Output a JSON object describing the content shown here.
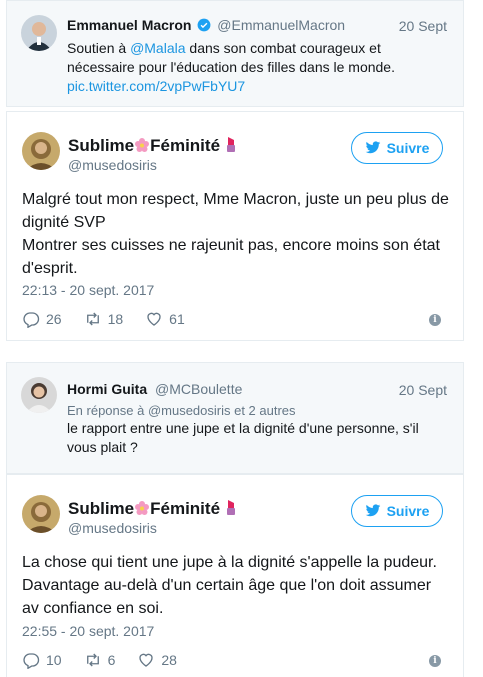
{
  "tweet1": {
    "name": "Emmanuel Macron",
    "handle": "@EmmanuelMacron",
    "date": "20 Sept",
    "text_line1_pre": "Soutien à ",
    "mention": "@Malala",
    "text_line1_post": " dans son combat courageux et",
    "text_line2": "nécessaire pour l'éducation des filles dans le monde.",
    "link": "pic.twitter.com/2vpPwFbYU7"
  },
  "tweet2": {
    "name_part1": "Sublime",
    "name_part2": "Féminité",
    "handle": "@musedosiris",
    "follow_label": "Suivre",
    "text_line1": "Malgré tout mon respect, Mme Macron, juste un peu plus de",
    "text_line2": "dignité SVP",
    "text_line3": "Montrer ses cuisses ne rajeunit pas, encore moins son état",
    "text_line4": "d'esprit.",
    "timestamp": "22:13 - 20 sept. 2017",
    "replies": "26",
    "retweets": "18",
    "likes": "61"
  },
  "tweet3": {
    "name": "Hormi Guita",
    "handle": "@MCBoulette",
    "date": "20 Sept",
    "reply_to": "En réponse à @musedosiris et 2 autres",
    "text_line1": "le rapport entre une jupe et la dignité d'une personne, s'il",
    "text_line2": "vous plait ?"
  },
  "tweet4": {
    "name_part1": "Sublime",
    "name_part2": "Féminité",
    "handle": "@musedosiris",
    "follow_label": "Suivre",
    "text_line1": "La chose qui tient une jupe à la dignité s'appelle la pudeur.",
    "text_line2": "Davantage au-delà d'un certain âge que l'on doit assumer",
    "text_line3": "av confiance en soi.",
    "timestamp": "22:55 - 20 sept. 2017",
    "replies": "10",
    "retweets": "6",
    "likes": "28"
  },
  "colors": {
    "accent": "#1da1f2",
    "link": "#1b95e0",
    "muted": "#657786",
    "reply_bg": "#f5f8fa",
    "border": "#e6ecf0"
  },
  "icons": [
    "verified-badge-icon",
    "flower-emoji-icon",
    "lipstick-emoji-icon",
    "twitter-bird-icon",
    "reply-icon",
    "retweet-icon",
    "like-icon",
    "info-icon"
  ]
}
